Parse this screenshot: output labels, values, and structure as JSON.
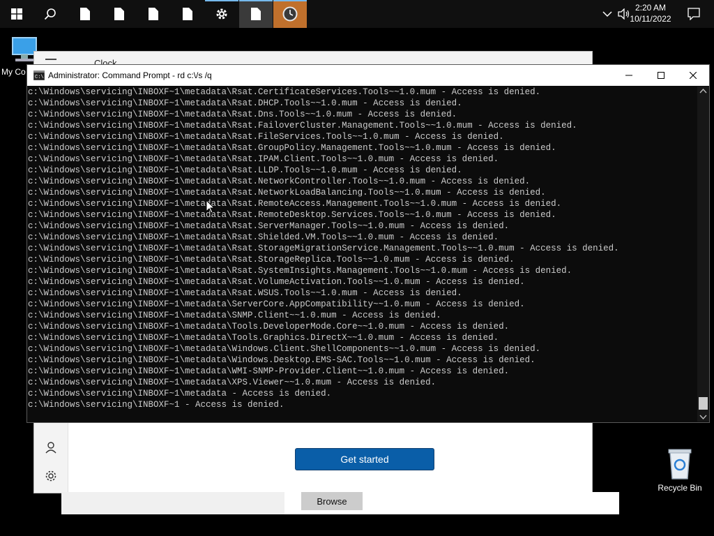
{
  "taskbar": {
    "apps": [
      {
        "name": "start",
        "icon": "windows-logo-icon"
      },
      {
        "name": "search",
        "icon": "search-icon"
      },
      {
        "name": "file-1",
        "icon": "document-icon"
      },
      {
        "name": "file-2",
        "icon": "document-icon"
      },
      {
        "name": "file-3",
        "icon": "document-icon"
      },
      {
        "name": "file-4",
        "icon": "document-icon"
      },
      {
        "name": "settings",
        "icon": "gear-icon"
      },
      {
        "name": "file-5",
        "icon": "document-icon"
      },
      {
        "name": "clock",
        "icon": "clock-icon"
      }
    ],
    "time": "2:20 AM",
    "date": "10/11/2022"
  },
  "desktop": {
    "my_computer_label": "My Co",
    "recycle_bin_label": "Recycle Bin"
  },
  "clock_window": {
    "title": "Clock",
    "get_started": "Get started"
  },
  "browse_window": {
    "browse": "Browse"
  },
  "cmd": {
    "title": "Administrator: Command Prompt - rd  c:\\/s /q",
    "lines": [
      "c:\\Windows\\servicing\\INBOXF~1\\metadata\\Rsat.CertificateServices.Tools~~1.0.mum - Access is denied.",
      "c:\\Windows\\servicing\\INBOXF~1\\metadata\\Rsat.DHCP.Tools~~1.0.mum - Access is denied.",
      "c:\\Windows\\servicing\\INBOXF~1\\metadata\\Rsat.Dns.Tools~~1.0.mum - Access is denied.",
      "c:\\Windows\\servicing\\INBOXF~1\\metadata\\Rsat.FailoverCluster.Management.Tools~~1.0.mum - Access is denied.",
      "c:\\Windows\\servicing\\INBOXF~1\\metadata\\Rsat.FileServices.Tools~~1.0.mum - Access is denied.",
      "c:\\Windows\\servicing\\INBOXF~1\\metadata\\Rsat.GroupPolicy.Management.Tools~~1.0.mum - Access is denied.",
      "c:\\Windows\\servicing\\INBOXF~1\\metadata\\Rsat.IPAM.Client.Tools~~1.0.mum - Access is denied.",
      "c:\\Windows\\servicing\\INBOXF~1\\metadata\\Rsat.LLDP.Tools~~1.0.mum - Access is denied.",
      "c:\\Windows\\servicing\\INBOXF~1\\metadata\\Rsat.NetworkController.Tools~~1.0.mum - Access is denied.",
      "c:\\Windows\\servicing\\INBOXF~1\\metadata\\Rsat.NetworkLoadBalancing.Tools~~1.0.mum - Access is denied.",
      "c:\\Windows\\servicing\\INBOXF~1\\metadata\\Rsat.RemoteAccess.Management.Tools~~1.0.mum - Access is denied.",
      "c:\\Windows\\servicing\\INBOXF~1\\metadata\\Rsat.RemoteDesktop.Services.Tools~~1.0.mum - Access is denied.",
      "c:\\Windows\\servicing\\INBOXF~1\\metadata\\Rsat.ServerManager.Tools~~1.0.mum - Access is denied.",
      "c:\\Windows\\servicing\\INBOXF~1\\metadata\\Rsat.Shielded.VM.Tools~~1.0.mum - Access is denied.",
      "c:\\Windows\\servicing\\INBOXF~1\\metadata\\Rsat.StorageMigrationService.Management.Tools~~1.0.mum - Access is denied.",
      "c:\\Windows\\servicing\\INBOXF~1\\metadata\\Rsat.StorageReplica.Tools~~1.0.mum - Access is denied.",
      "c:\\Windows\\servicing\\INBOXF~1\\metadata\\Rsat.SystemInsights.Management.Tools~~1.0.mum - Access is denied.",
      "c:\\Windows\\servicing\\INBOXF~1\\metadata\\Rsat.VolumeActivation.Tools~~1.0.mum - Access is denied.",
      "c:\\Windows\\servicing\\INBOXF~1\\metadata\\Rsat.WSUS.Tools~~1.0.mum - Access is denied.",
      "c:\\Windows\\servicing\\INBOXF~1\\metadata\\ServerCore.AppCompatibility~~1.0.mum - Access is denied.",
      "c:\\Windows\\servicing\\INBOXF~1\\metadata\\SNMP.Client~~1.0.mum - Access is denied.",
      "c:\\Windows\\servicing\\INBOXF~1\\metadata\\Tools.DeveloperMode.Core~~1.0.mum - Access is denied.",
      "c:\\Windows\\servicing\\INBOXF~1\\metadata\\Tools.Graphics.DirectX~~1.0.mum - Access is denied.",
      "c:\\Windows\\servicing\\INBOXF~1\\metadata\\Windows.Client.ShellComponents~~1.0.mum - Access is denied.",
      "c:\\Windows\\servicing\\INBOXF~1\\metadata\\Windows.Desktop.EMS-SAC.Tools~~1.0.mum - Access is denied.",
      "c:\\Windows\\servicing\\INBOXF~1\\metadata\\WMI-SNMP-Provider.Client~~1.0.mum - Access is denied.",
      "c:\\Windows\\servicing\\INBOXF~1\\metadata\\XPS.Viewer~~1.0.mum - Access is denied.",
      "c:\\Windows\\servicing\\INBOXF~1\\metadata - Access is denied.",
      "c:\\Windows\\servicing\\INBOXF~1 - Access is denied."
    ]
  },
  "colors": {
    "taskbar_bg": "#101010",
    "console_bg": "#0c0c0c",
    "console_text": "#cccccc",
    "accent": "#0a5ea8",
    "clock_app_bg": "#c0702c"
  }
}
